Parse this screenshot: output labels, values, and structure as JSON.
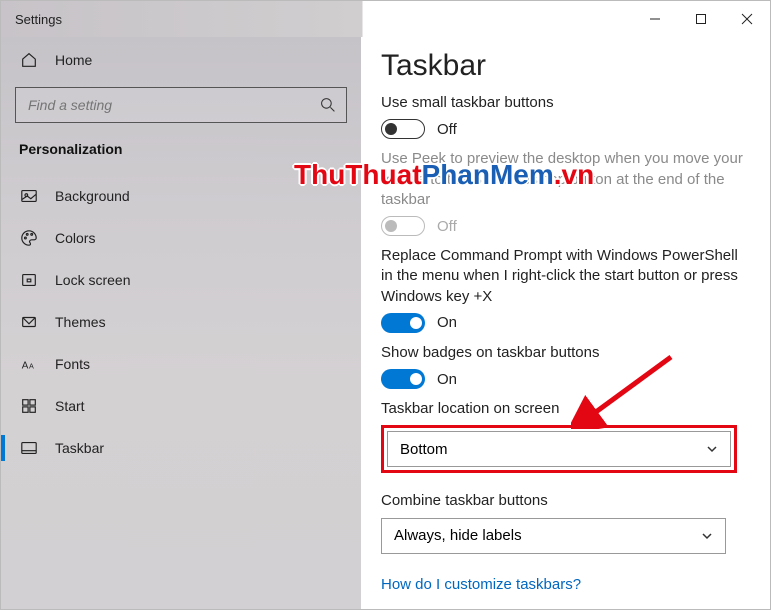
{
  "window": {
    "title": "Settings"
  },
  "sidebar": {
    "home": "Home",
    "search_placeholder": "Find a setting",
    "category": "Personalization",
    "items": [
      {
        "label": "Background"
      },
      {
        "label": "Colors"
      },
      {
        "label": "Lock screen"
      },
      {
        "label": "Themes"
      },
      {
        "label": "Fonts"
      },
      {
        "label": "Start"
      },
      {
        "label": "Taskbar"
      }
    ]
  },
  "content": {
    "title": "Taskbar",
    "small_buttons": {
      "label": "Use small taskbar buttons",
      "state": "Off"
    },
    "peek": {
      "label": "Use Peek to preview the desktop when you move your mouse to the Show desktop button at the end of the taskbar",
      "state": "Off"
    },
    "powershell": {
      "label": "Replace Command Prompt with Windows PowerShell in the menu when I right-click the start button or press Windows key +X",
      "state": "On"
    },
    "badges": {
      "label": "Show badges on taskbar buttons",
      "state": "On"
    },
    "location": {
      "label": "Taskbar location on screen",
      "value": "Bottom"
    },
    "combine": {
      "label": "Combine taskbar buttons",
      "value": "Always, hide labels"
    },
    "help": "How do I customize taskbars?"
  },
  "watermark": {
    "part1": "ThuThuat",
    "part2": "PhanMem",
    "part3": ".vn"
  }
}
